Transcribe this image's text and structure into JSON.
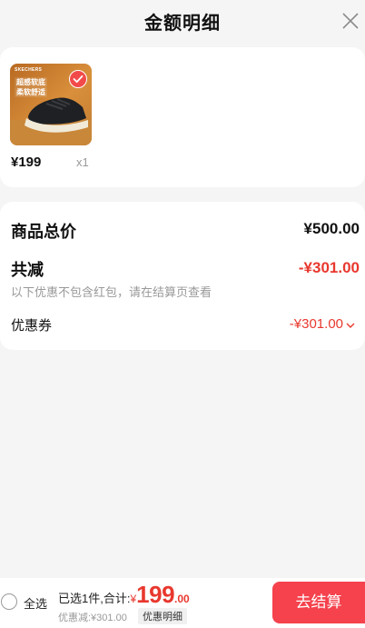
{
  "header": {
    "title": "金额明细"
  },
  "product": {
    "brand_text": "SKECHERS",
    "tag_line1": "超感软底",
    "tag_line2": "柔软舒适",
    "price": "¥199",
    "qty": "x1"
  },
  "summary": {
    "total_label": "商品总价",
    "total_value": "¥500.00",
    "reduce_label": "共减",
    "reduce_value": "-¥301.00",
    "reduce_note": "以下优惠不包含红包，请在结算页查看",
    "coupon_label": "优惠券",
    "coupon_value": "-¥301.00"
  },
  "bottom": {
    "select_all": "全选",
    "selected_text": "已选1件,合计:",
    "currency": "¥",
    "total_int": "199",
    "total_dec": ".00",
    "discount_text": "优惠减:¥301.00",
    "detail_tag": "优惠明细",
    "checkout": "去结算"
  },
  "colors": {
    "accent_red": "#e8382e",
    "checkout_bg": "#f5424d"
  },
  "icons": {
    "close": "close-icon",
    "check": "check-icon",
    "chevron": "chevron-down-icon"
  }
}
